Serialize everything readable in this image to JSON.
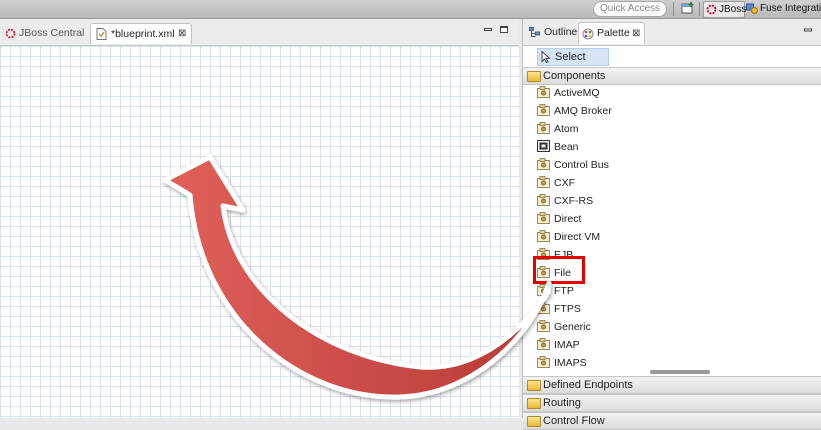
{
  "toolbar": {
    "quick_access_placeholder": "Quick Access",
    "perspectives": [
      {
        "label": "JBoss",
        "active": true
      },
      {
        "label": "Fuse Integration",
        "active": false
      }
    ]
  },
  "editor": {
    "tabs": [
      {
        "label": "JBoss Central",
        "active": false,
        "closable": false
      },
      {
        "label": "*blueprint.xml",
        "active": true,
        "closable": true
      }
    ]
  },
  "panel": {
    "tabs": [
      {
        "label": "Outline",
        "active": false
      },
      {
        "label": "Palette",
        "active": true,
        "closable": true
      }
    ],
    "select_label": "Select",
    "drawers": {
      "components": "Components",
      "defined_endpoints": "Defined Endpoints",
      "routing": "Routing",
      "control_flow": "Control Flow"
    },
    "components": [
      {
        "label": "ActiveMQ",
        "icon": "endpoint-icon"
      },
      {
        "label": "AMQ Broker",
        "icon": "endpoint-icon"
      },
      {
        "label": "Atom",
        "icon": "endpoint-icon"
      },
      {
        "label": "Bean",
        "icon": "bean-icon"
      },
      {
        "label": "Control Bus",
        "icon": "endpoint-icon"
      },
      {
        "label": "CXF",
        "icon": "endpoint-icon"
      },
      {
        "label": "CXF-RS",
        "icon": "endpoint-icon"
      },
      {
        "label": "Direct",
        "icon": "endpoint-icon"
      },
      {
        "label": "Direct VM",
        "icon": "endpoint-icon"
      },
      {
        "label": "EJB",
        "icon": "endpoint-icon"
      },
      {
        "label": "File",
        "icon": "endpoint-icon",
        "highlighted": true
      },
      {
        "label": "FTP",
        "icon": "endpoint-icon"
      },
      {
        "label": "FTPS",
        "icon": "endpoint-icon"
      },
      {
        "label": "Generic",
        "icon": "endpoint-icon"
      },
      {
        "label": "IMAP",
        "icon": "endpoint-icon"
      },
      {
        "label": "IMAPS",
        "icon": "endpoint-icon"
      }
    ]
  },
  "colors": {
    "highlight_box": "#e50000",
    "arrow_fill": "#d9534f",
    "grid_line": "#d8e3ef",
    "selection": "#d6e5f6"
  }
}
